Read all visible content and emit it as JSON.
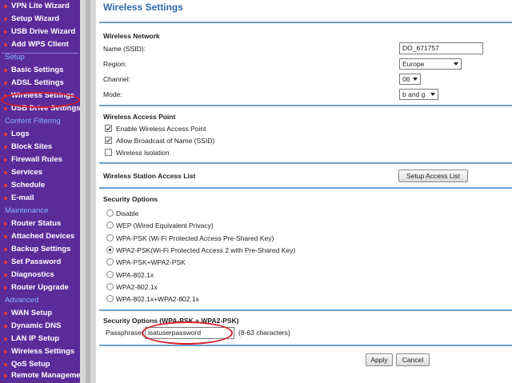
{
  "sidebar": {
    "items": [
      {
        "type": "item",
        "label": "VPN Lite Wizard"
      },
      {
        "type": "item",
        "label": "Setup Wizard"
      },
      {
        "type": "item",
        "label": "USB Drive Wizard"
      },
      {
        "type": "item",
        "label": "Add WPS Client"
      },
      {
        "type": "section",
        "label": "Setup"
      },
      {
        "type": "item",
        "label": "Basic Settings"
      },
      {
        "type": "item",
        "label": "ADSL Settings"
      },
      {
        "type": "item",
        "label": "Wireless Settings",
        "active": true
      },
      {
        "type": "item",
        "label": "USB Drive Settings"
      },
      {
        "type": "section",
        "label": "Content Filtering"
      },
      {
        "type": "item",
        "label": "Logs"
      },
      {
        "type": "item",
        "label": "Block Sites"
      },
      {
        "type": "item",
        "label": "Firewall Rules"
      },
      {
        "type": "item",
        "label": "Services"
      },
      {
        "type": "item",
        "label": "Schedule"
      },
      {
        "type": "item",
        "label": "E-mail"
      },
      {
        "type": "section",
        "label": "Maintenance"
      },
      {
        "type": "item",
        "label": "Router Status"
      },
      {
        "type": "item",
        "label": "Attached Devices"
      },
      {
        "type": "item",
        "label": "Backup Settings"
      },
      {
        "type": "item",
        "label": "Set Password"
      },
      {
        "type": "item",
        "label": "Diagnostics"
      },
      {
        "type": "item",
        "label": "Router Upgrade"
      },
      {
        "type": "section",
        "label": "Advanced"
      },
      {
        "type": "item",
        "label": "WAN Setup"
      },
      {
        "type": "item",
        "label": "Dynamic DNS"
      },
      {
        "type": "item",
        "label": "LAN IP Setup"
      },
      {
        "type": "item",
        "label": "Wireless Settings"
      },
      {
        "type": "item",
        "label": "QoS Setup"
      },
      {
        "type": "item",
        "label": "Remote Management",
        "two_line": true
      }
    ],
    "colors": {
      "background": "#5b2b9a",
      "section": "#7fb8ff",
      "bullet": "#e63a3a",
      "highlight": "#d81e2a"
    }
  },
  "main": {
    "title": "Wireless Settings",
    "wireless_network": {
      "heading": "Wireless Network",
      "ssid_label": "Name (SSID):",
      "ssid_value": "DO_671757",
      "region_label": "Region:",
      "region_value": "Europe",
      "channel_label": "Channel:",
      "channel_value": "06",
      "mode_label": "Mode:",
      "mode_value": "b and g"
    },
    "access_point": {
      "heading": "Wireless Access Point",
      "enable_label": "Enable Wireless Access Point",
      "enable_checked": true,
      "broadcast_label": "Allow Broadcast of Name (SSID)",
      "broadcast_checked": true,
      "isolation_label": "Wireless Isolation",
      "isolation_checked": false
    },
    "station_list": {
      "heading": "Wireless Station Access List",
      "button": "Setup Access List"
    },
    "security": {
      "heading": "Security Options",
      "selected_index": 3,
      "options": [
        "Disable",
        "WEP (Wired Equivalent Privacy)",
        "WPA-PSK (Wi-Fi Protected Access Pre-Shared Key)",
        "WPA2-PSK(Wi-Fi Protected Access 2 with Pre-Shared Key)",
        "WPA-PSK+WPA2-PSK",
        "WPA-802.1x",
        "WPA2-802.1x",
        "WPA-802.1x+WPA2-802.1x"
      ]
    },
    "security_detail": {
      "heading": "Security Options (WPA-PSK + WPA2-PSK)",
      "passphrase_label": "Passphrase:",
      "passphrase_value": "isatuserpassword",
      "hint": "(8-63 characters)"
    },
    "buttons": {
      "apply": "Apply",
      "cancel": "Cancel"
    },
    "colors": {
      "title": "#2d6aa8",
      "rule": "#6aa0d0"
    }
  }
}
